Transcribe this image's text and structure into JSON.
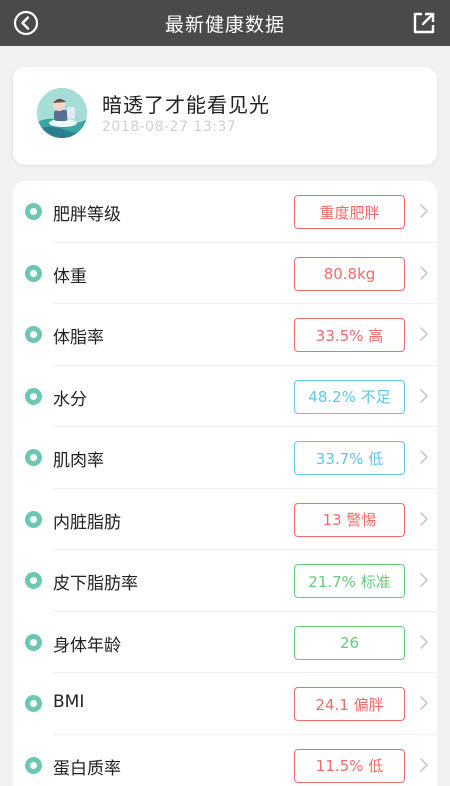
{
  "header": {
    "title": "最新健康数据"
  },
  "profile": {
    "name": "暗透了才能看见光",
    "timestamp": "2018-08-27 13:37"
  },
  "colors": {
    "red": "#f06b6b",
    "blue": "#61c5ec",
    "green": "#68cc7d",
    "dot": "#6ec7b3"
  },
  "metrics": [
    {
      "label": "肥胖等级",
      "value": "重度肥胖",
      "status": "red"
    },
    {
      "label": "体重",
      "value": "80.8kg",
      "status": "red"
    },
    {
      "label": "体脂率",
      "value": "33.5% 高",
      "status": "red"
    },
    {
      "label": "水分",
      "value": "48.2% 不足",
      "status": "blue"
    },
    {
      "label": "肌肉率",
      "value": "33.7% 低",
      "status": "blue"
    },
    {
      "label": "内脏脂肪",
      "value": "13 警惕",
      "status": "red"
    },
    {
      "label": "皮下脂肪率",
      "value": "21.7% 标准",
      "status": "green"
    },
    {
      "label": "身体年龄",
      "value": "26",
      "status": "green"
    },
    {
      "label": "BMI",
      "value": "24.1 偏胖",
      "status": "red"
    },
    {
      "label": "蛋白质率",
      "value": "11.5% 低",
      "status": "red"
    }
  ]
}
